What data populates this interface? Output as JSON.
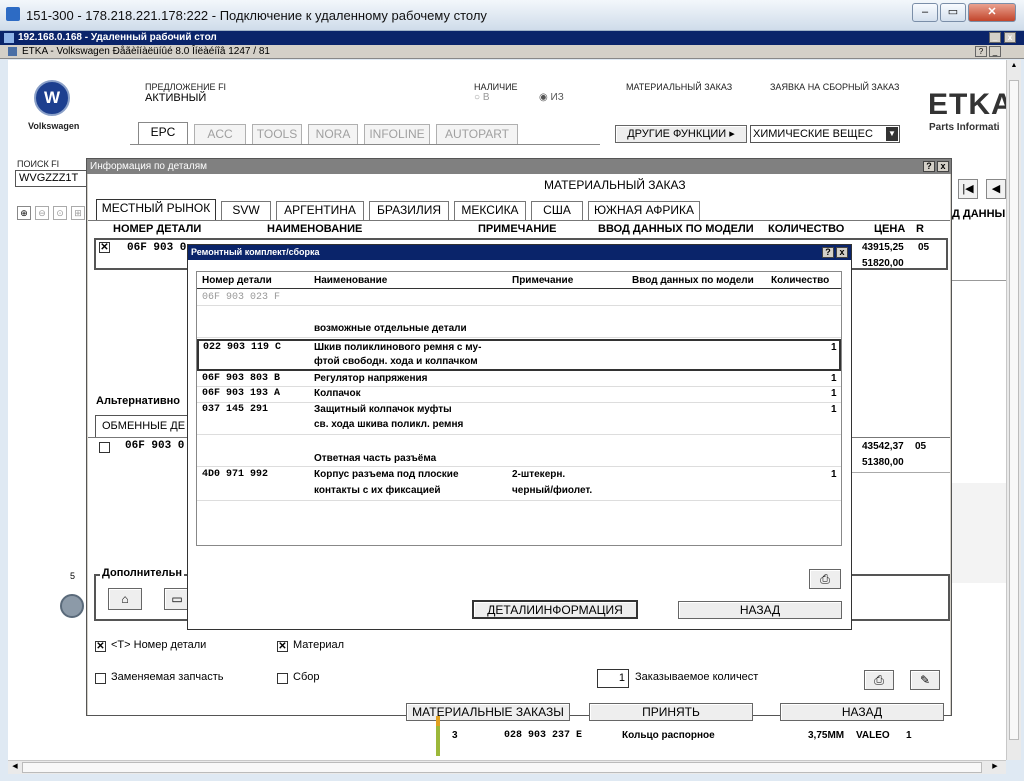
{
  "rdp": {
    "title": "151-300 - 178.218.221.178:222 - Подключение к удаленному рабочему столу",
    "session_title": "192.168.0.168 - Удаленный рабочий стол",
    "etka_title": "ETKA - Volkswagen Ðåãèîíàëüíûé 8.0 Îíëàéíîâ 1247 / 81"
  },
  "header": {
    "brand": "Volkswagen",
    "offer_label": "ПРЕДЛОЖЕНИЕ FI",
    "offer_status": "АКТИВНЫЙ",
    "availability_label": "НАЛИЧИЕ",
    "availability_in": "В",
    "availability_from": "ИЗ",
    "material_order": "МАТЕРИАЛЬНЫЙ ЗАКАЗ",
    "assembly_order": "ЗАЯВКА НА СБОРНЫЙ ЗАКАЗ",
    "etka_logo": "ETKA",
    "etka_sub": "Parts Informati",
    "other_functions": "ДРУГИЕ ФУНКЦИИ ▸",
    "chemicals": "ХИМИЧЕСКИЕ ВЕЩЕС",
    "search_label": "ПОИСК FI",
    "search_value": "WVGZZZ1T"
  },
  "tabs": [
    "EPC",
    "ACC",
    "TOOLS",
    "NORA",
    "INFOLINE",
    "AUTOPART"
  ],
  "info_dialog": {
    "title": "Информация по деталям",
    "subtitle": "МАТЕРИАЛЬНЫЙ ЗАКАЗ",
    "market_tabs": [
      "МЕСТНЫЙ РЫНОК",
      "SVW",
      "АРГЕНТИНА",
      "БРАЗИЛИЯ",
      "МЕКСИКА",
      "США",
      "ЮЖНАЯ АФРИКА"
    ],
    "columns": [
      "НОМЕР ДЕТАЛИ",
      "НАИМЕНОВАНИЕ",
      "ПРИМЕЧАНИЕ",
      "ВВОД ДАННЫХ ПО МОДЕЛИ",
      "КОЛИЧЕСТВО",
      "ЦЕНА",
      "R"
    ],
    "row1": {
      "part": "06F 903 0",
      "price1": "43915,25",
      "price2": "51820,00",
      "r": "05"
    },
    "alternative_label": "Альтернативно",
    "exchange_tab": "ОБМЕННЫЕ ДЕ",
    "row2": {
      "part": "06F 903 0",
      "price1": "43542,37",
      "price2": "51380,00",
      "r": "05"
    },
    "additional_label": "Дополнительн",
    "cb_part_no": "<T> Номер детали",
    "cb_material": "Материал",
    "cb_replaceable": "Заменяемая запчасть",
    "cb_assembly": "Сбор",
    "qty_value": "1",
    "qty_label": "Заказываемое количест",
    "btn_material_orders": "МАТЕРИАЛЬНЫЕ ЗАКАЗЫ",
    "btn_accept": "ПРИНЯТЬ",
    "btn_back": "НАЗАД",
    "right_hdr": "Д ДАННЫ"
  },
  "kit_dialog": {
    "title": "Ремонтный комплект/сборка",
    "columns": [
      "Номер детали",
      "Наименование",
      "Примечание",
      "Ввод данных по модели",
      "Количество"
    ],
    "rows": [
      {
        "part": "06F 903 023 F",
        "name": "",
        "note": "",
        "qty": "",
        "grey": true
      },
      {
        "part": "",
        "name": "возможные отдельные детали",
        "note": "",
        "qty": ""
      },
      {
        "part": "022 903 119 C",
        "name": "Шкив поликлинового ремня с му-",
        "name2": "фтой свободн. хода и колпачком",
        "note": "",
        "qty": "1"
      },
      {
        "part": "06F 903 803 B",
        "name": "Регулятор напряжения",
        "note": "",
        "qty": "1"
      },
      {
        "part": "06F 903 193 A",
        "name": "Колпачок",
        "note": "",
        "qty": "1"
      },
      {
        "part": "037 145 291",
        "name": "Защитный колпачок муфты",
        "name2": "св. хода шкива поликл. ремня",
        "note": "",
        "qty": "1"
      },
      {
        "part": "",
        "name": "Ответная часть разъёма",
        "note": "",
        "qty": ""
      },
      {
        "part": "4D0 971 992",
        "name": "Корпус разъема под плоские",
        "name2": "контакты с их фиксацией",
        "note": "2-штекерн.",
        "note2": "черный/фиолет.",
        "qty": "1"
      }
    ],
    "btn_details": "ДЕТАЛИИНФОРМАЦИЯ",
    "btn_back": "НАЗАД"
  },
  "bottom_row": {
    "pos": "3",
    "part": "028 903 237 E",
    "name": "Кольцо распорное",
    "size": "3,75MM",
    "brand": "VALEO",
    "qty": "1"
  },
  "side_number": "5"
}
